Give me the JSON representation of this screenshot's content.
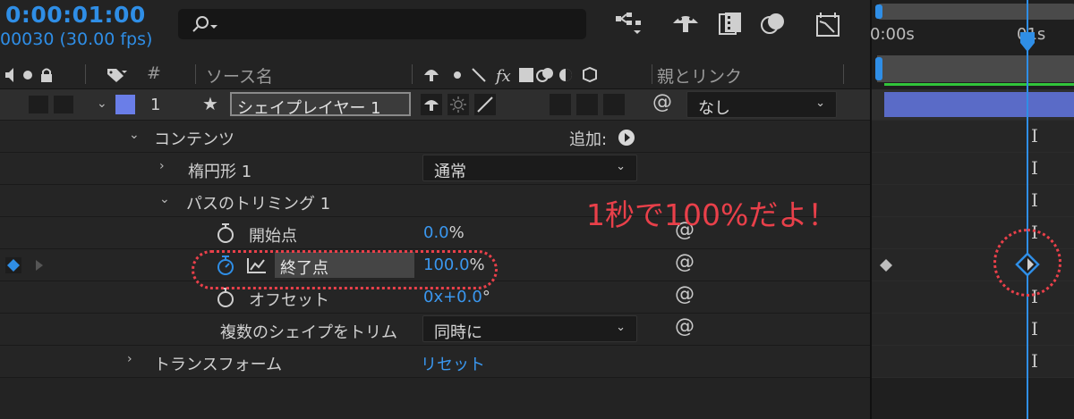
{
  "header": {
    "timecode": "0:00:01:00",
    "fps": "00030 (30.00 fps)",
    "search_placeholder": ""
  },
  "columns": {
    "hash": "#",
    "source_name": "ソース名",
    "parent_link": "親とリンク"
  },
  "layer": {
    "index": "1",
    "name": "シェイプレイヤー 1",
    "parent_value": "なし"
  },
  "contents": {
    "label": "コンテンツ",
    "add_label": "追加:"
  },
  "ellipse": {
    "label": "楕円形 1",
    "blend_mode": "通常"
  },
  "trim_paths": {
    "label": "パスのトリミング 1",
    "start_label": "開始点",
    "start_value": "0.0",
    "start_unit": "%",
    "end_label": "終了点",
    "end_value": "100.0",
    "end_unit": "%",
    "offset_label": "オフセット",
    "offset_value": "0x+0.0",
    "offset_unit": "°",
    "multi_label": "複数のシェイプをトリム",
    "multi_value": "同時に"
  },
  "transform": {
    "label": "トランスフォーム",
    "reset_label": "リセット"
  },
  "timeline": {
    "tick_0": "0:00s",
    "tick_1": "01s",
    "playhead_fraction": 0.76
  },
  "annotation": "1秒で100%だよ！",
  "colors": {
    "accent": "#2f8ee6",
    "layer_color": "#6a7ee8",
    "annotation": "#e9404a",
    "layer_bar": "#5a6bc7"
  }
}
